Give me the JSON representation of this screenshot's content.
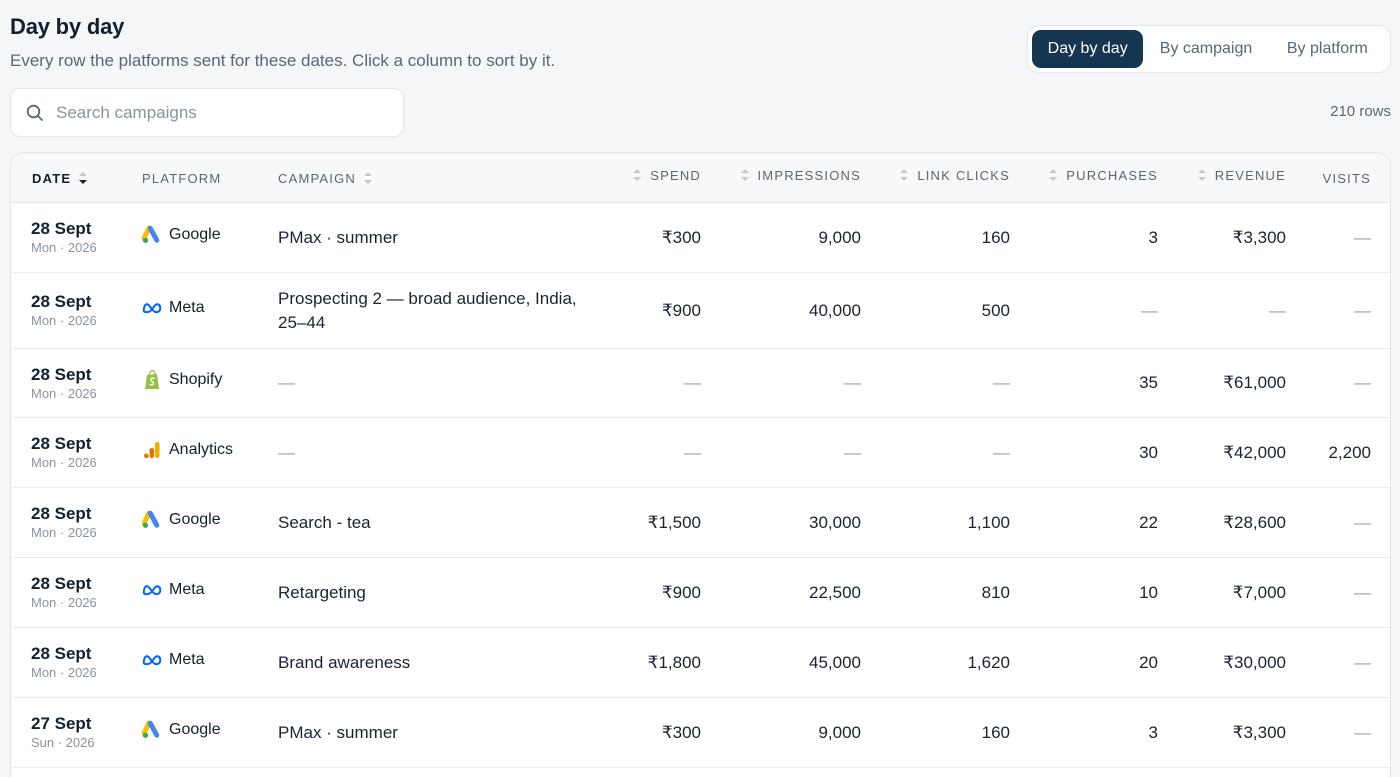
{
  "header": {
    "title": "Day by day",
    "subtitle": "Every row the platforms sent for these dates. Click a column to sort by it."
  },
  "view_tabs": [
    "Day by day",
    "By campaign",
    "By platform"
  ],
  "search": {
    "placeholder": "Search campaigns",
    "value": ""
  },
  "row_count": "210 rows",
  "columns": {
    "date": "DATE",
    "platform": "PLATFORM",
    "campaign": "CAMPAIGN",
    "spend": "SPEND",
    "impressions": "IMPRESSIONS",
    "link_clicks": "LINK CLICKS",
    "purchases": "PURCHASES",
    "revenue": "REVENUE",
    "visits": "VISITS"
  },
  "rows": [
    {
      "date": "28 Sept",
      "day": "Mon · 2026",
      "platform": "Google",
      "campaign": "PMax · summer",
      "spend": "₹300",
      "impressions": "9,000",
      "link_clicks": "160",
      "purchases": "3",
      "revenue": "₹3,300",
      "visits": "—"
    },
    {
      "date": "28 Sept",
      "day": "Mon · 2026",
      "platform": "Meta",
      "campaign": "Prospecting 2 — broad audience, India, 25–44",
      "spend": "₹900",
      "impressions": "40,000",
      "link_clicks": "500",
      "purchases": "—",
      "revenue": "—",
      "visits": "—"
    },
    {
      "date": "28 Sept",
      "day": "Mon · 2026",
      "platform": "Shopify",
      "campaign": "—",
      "spend": "—",
      "impressions": "—",
      "link_clicks": "—",
      "purchases": "35",
      "revenue": "₹61,000",
      "visits": "—"
    },
    {
      "date": "28 Sept",
      "day": "Mon · 2026",
      "platform": "Analytics",
      "campaign": "—",
      "spend": "—",
      "impressions": "—",
      "link_clicks": "—",
      "purchases": "30",
      "revenue": "₹42,000",
      "visits": "2,200"
    },
    {
      "date": "28 Sept",
      "day": "Mon · 2026",
      "platform": "Google",
      "campaign": "Search - tea",
      "spend": "₹1,500",
      "impressions": "30,000",
      "link_clicks": "1,100",
      "purchases": "22",
      "revenue": "₹28,600",
      "visits": "—"
    },
    {
      "date": "28 Sept",
      "day": "Mon · 2026",
      "platform": "Meta",
      "campaign": "Retargeting",
      "spend": "₹900",
      "impressions": "22,500",
      "link_clicks": "810",
      "purchases": "10",
      "revenue": "₹7,000",
      "visits": "—"
    },
    {
      "date": "28 Sept",
      "day": "Mon · 2026",
      "platform": "Meta",
      "campaign": "Brand awareness",
      "spend": "₹1,800",
      "impressions": "45,000",
      "link_clicks": "1,620",
      "purchases": "20",
      "revenue": "₹30,000",
      "visits": "—"
    },
    {
      "date": "27 Sept",
      "day": "Sun · 2026",
      "platform": "Google",
      "campaign": "PMax · summer",
      "spend": "₹300",
      "impressions": "9,000",
      "link_clicks": "160",
      "purchases": "3",
      "revenue": "₹3,300",
      "visits": "—"
    }
  ]
}
